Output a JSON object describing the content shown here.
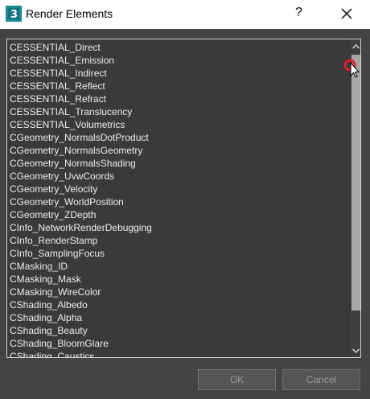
{
  "window": {
    "title": "Render Elements",
    "help_label": "?"
  },
  "icons": {
    "app": "3ds-max-app-icon",
    "close": "close-icon",
    "help": "help-icon",
    "up": "chevron-up-icon",
    "down": "chevron-down-icon"
  },
  "list": {
    "items": [
      "CESSENTIAL_Direct",
      "CESSENTIAL_Emission",
      "CESSENTIAL_Indirect",
      "CESSENTIAL_Reflect",
      "CESSENTIAL_Refract",
      "CESSENTIAL_Translucency",
      "CESSENTIAL_Volumetrics",
      "CGeometry_NormalsDotProduct",
      "CGeometry_NormalsGeometry",
      "CGeometry_NormalsShading",
      "CGeometry_UvwCoords",
      "CGeometry_Velocity",
      "CGeometry_WorldPosition",
      "CGeometry_ZDepth",
      "CInfo_NetworkRenderDebugging",
      "CInfo_RenderStamp",
      "CInfo_SamplingFocus",
      "CMasking_ID",
      "CMasking_Mask",
      "CMasking_WireColor",
      "CShading_Albedo",
      "CShading_Alpha",
      "CShading_Beauty",
      "CShading_BloomGlare",
      "CShading_Caustics"
    ]
  },
  "buttons": {
    "ok": "OK",
    "cancel": "Cancel"
  },
  "colors": {
    "background": "#444444",
    "list_bg": "#3a3a3a",
    "text": "#ececec",
    "thumb": "#a7a7a7",
    "marker": "#e0202e"
  }
}
